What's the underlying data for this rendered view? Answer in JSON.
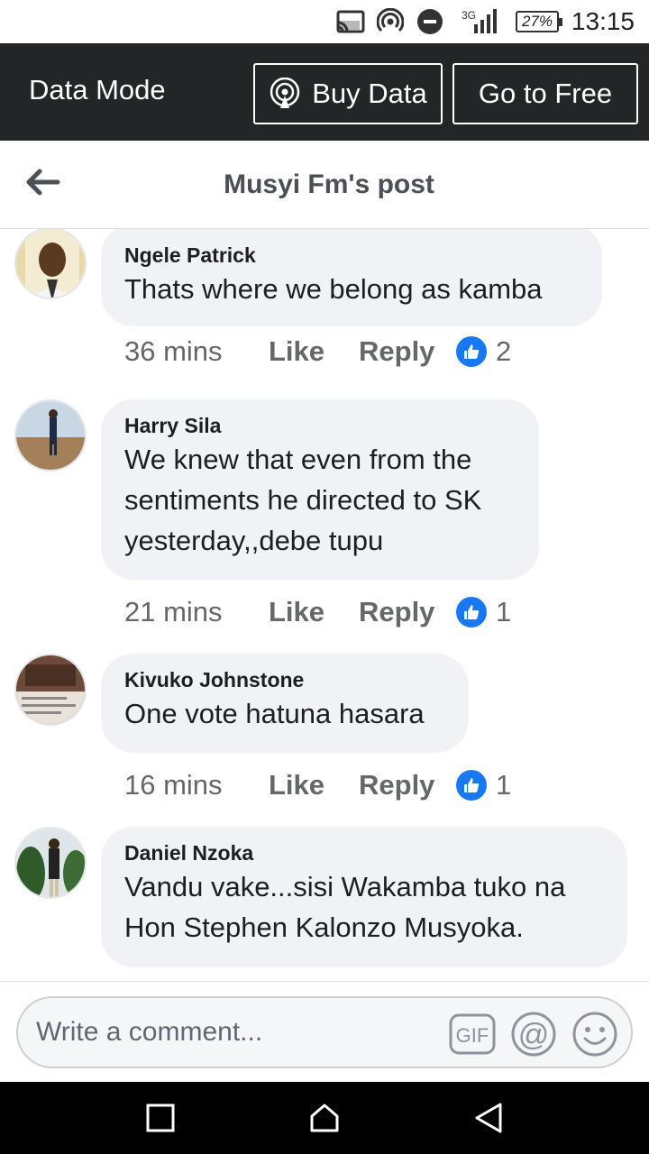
{
  "status_bar": {
    "network_label": "3G",
    "battery": "27%",
    "time": "13:15"
  },
  "data_mode": {
    "label": "Data Mode",
    "buy_data": "Buy Data",
    "go_free": "Go to Free"
  },
  "header": {
    "title": "Musyi Fm's post"
  },
  "comments": [
    {
      "author": "Ngele Patrick",
      "text": "Thats where we belong as kamba",
      "time": "36 mins",
      "like": "Like",
      "reply": "Reply",
      "reactions": "2"
    },
    {
      "author": "Harry Sila",
      "text": "We knew that even from the sentiments he directed to SK yesterday,,debe tupu",
      "time": "21 mins",
      "like": "Like",
      "reply": "Reply",
      "reactions": "1"
    },
    {
      "author": "Kivuko Johnstone",
      "text": "One vote hatuna hasara",
      "time": "16 mins",
      "like": "Like",
      "reply": "Reply",
      "reactions": "1"
    },
    {
      "author": "Daniel Nzoka",
      "text": "Vandu vake...sisi Wakamba tuko na Hon Stephen Kalonzo Musyoka.",
      "time": "",
      "like": "",
      "reply": "",
      "reactions": ""
    }
  ],
  "composer": {
    "placeholder": "Write a comment...",
    "gif_label": "GIF",
    "mention_label": "@"
  },
  "colors": {
    "data_bar": "#242526",
    "bubble": "#f0f2f5",
    "like_blue": "#1877f2"
  },
  "icons": [
    "cast-icon",
    "hotspot-icon",
    "do-not-disturb-icon",
    "signal-icon",
    "battery-icon",
    "back-arrow-icon",
    "thumbs-up-icon",
    "emoji-icon",
    "nav-recents-icon",
    "nav-home-icon",
    "nav-back-icon"
  ]
}
